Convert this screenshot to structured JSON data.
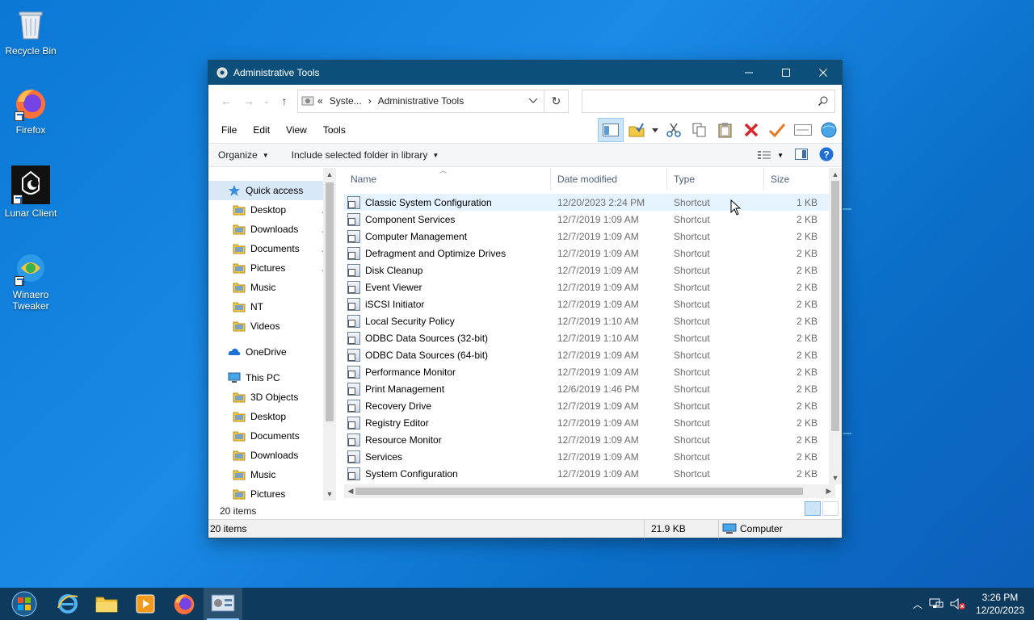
{
  "desktop": {
    "icons": [
      {
        "label": "Recycle Bin"
      },
      {
        "label": "Firefox"
      },
      {
        "label": "Lunar Client"
      },
      {
        "label": "Winaero Tweaker"
      }
    ]
  },
  "window": {
    "title": "Administrative Tools",
    "address": {
      "prefix": "«",
      "crumb1": "Syste...",
      "sep": "›",
      "crumb2": "Administrative Tools"
    },
    "search_placeholder": "",
    "menu": [
      "File",
      "Edit",
      "View",
      "Tools"
    ],
    "commands": {
      "organize": "Organize",
      "include": "Include selected folder in library"
    },
    "nav": {
      "items": [
        {
          "label": "Quick access",
          "type": "quick"
        },
        {
          "label": "Desktop",
          "pinned": true
        },
        {
          "label": "Downloads",
          "pinned": true
        },
        {
          "label": "Documents",
          "pinned": true
        },
        {
          "label": "Pictures",
          "pinned": true
        },
        {
          "label": "Music"
        },
        {
          "label": "NT"
        },
        {
          "label": "Videos"
        },
        {
          "label": "OneDrive",
          "type": "onedrive"
        },
        {
          "label": "This PC",
          "type": "pc"
        },
        {
          "label": "3D Objects"
        },
        {
          "label": "Desktop"
        },
        {
          "label": "Documents"
        },
        {
          "label": "Downloads"
        },
        {
          "label": "Music"
        },
        {
          "label": "Pictures"
        }
      ]
    },
    "columns": {
      "name": "Name",
      "date": "Date modified",
      "type": "Type",
      "size": "Size"
    },
    "files": [
      {
        "name": "Classic System Configuration",
        "date": "12/20/2023 2:24 PM",
        "type": "Shortcut",
        "size": "1 KB"
      },
      {
        "name": "Component Services",
        "date": "12/7/2019 1:09 AM",
        "type": "Shortcut",
        "size": "2 KB"
      },
      {
        "name": "Computer Management",
        "date": "12/7/2019 1:09 AM",
        "type": "Shortcut",
        "size": "2 KB"
      },
      {
        "name": "Defragment and Optimize Drives",
        "date": "12/7/2019 1:09 AM",
        "type": "Shortcut",
        "size": "2 KB"
      },
      {
        "name": "Disk Cleanup",
        "date": "12/7/2019 1:09 AM",
        "type": "Shortcut",
        "size": "2 KB"
      },
      {
        "name": "Event Viewer",
        "date": "12/7/2019 1:09 AM",
        "type": "Shortcut",
        "size": "2 KB"
      },
      {
        "name": "iSCSI Initiator",
        "date": "12/7/2019 1:09 AM",
        "type": "Shortcut",
        "size": "2 KB"
      },
      {
        "name": "Local Security Policy",
        "date": "12/7/2019 1:10 AM",
        "type": "Shortcut",
        "size": "2 KB"
      },
      {
        "name": "ODBC Data Sources (32-bit)",
        "date": "12/7/2019 1:10 AM",
        "type": "Shortcut",
        "size": "2 KB"
      },
      {
        "name": "ODBC Data Sources (64-bit)",
        "date": "12/7/2019 1:09 AM",
        "type": "Shortcut",
        "size": "2 KB"
      },
      {
        "name": "Performance Monitor",
        "date": "12/7/2019 1:09 AM",
        "type": "Shortcut",
        "size": "2 KB"
      },
      {
        "name": "Print Management",
        "date": "12/6/2019 1:46 PM",
        "type": "Shortcut",
        "size": "2 KB"
      },
      {
        "name": "Recovery Drive",
        "date": "12/7/2019 1:09 AM",
        "type": "Shortcut",
        "size": "2 KB"
      },
      {
        "name": "Registry Editor",
        "date": "12/7/2019 1:09 AM",
        "type": "Shortcut",
        "size": "2 KB"
      },
      {
        "name": "Resource Monitor",
        "date": "12/7/2019 1:09 AM",
        "type": "Shortcut",
        "size": "2 KB"
      },
      {
        "name": "Services",
        "date": "12/7/2019 1:09 AM",
        "type": "Shortcut",
        "size": "2 KB"
      },
      {
        "name": "System Configuration",
        "date": "12/7/2019 1:09 AM",
        "type": "Shortcut",
        "size": "2 KB"
      }
    ],
    "inner_count": "20 items",
    "status": {
      "items": "20 items",
      "size": "21.9 KB",
      "location": "Computer"
    }
  },
  "taskbar": {
    "time": "3:26 PM",
    "date": "12/20/2023"
  },
  "colors": {
    "titlebar": "#0b4f7a",
    "taskbar": "#0e3a5e",
    "desktop": "#0a78d4"
  }
}
